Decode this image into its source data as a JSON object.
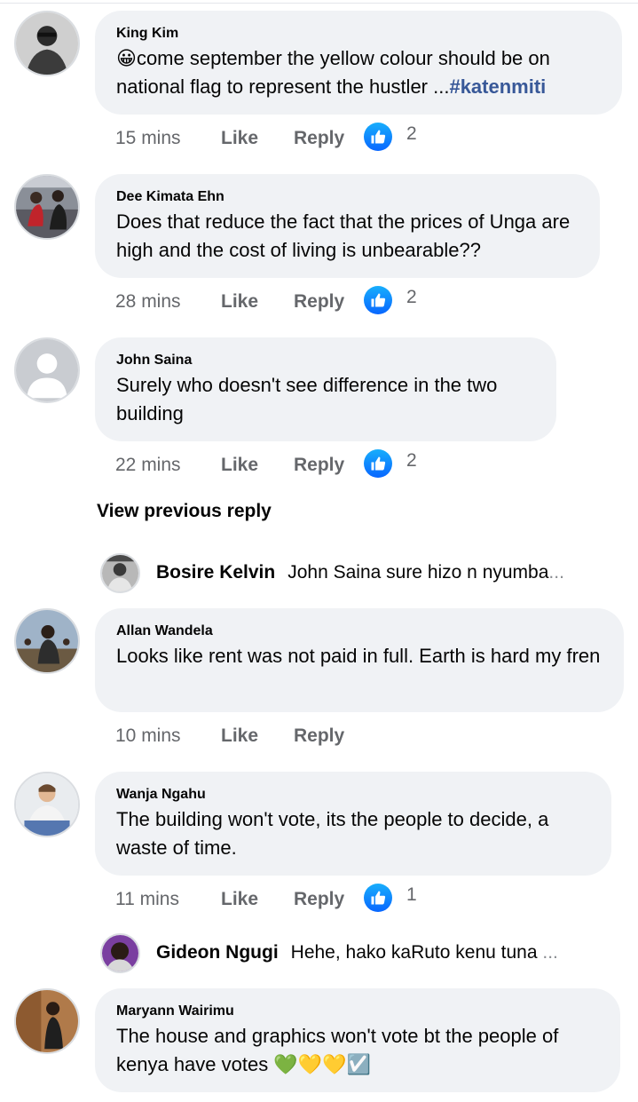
{
  "comments": [
    {
      "author": "King Kim",
      "emoji": "😀",
      "text": "come september the yellow colour should be on national flag to represent the hustler ...",
      "hashtag": "#katenmiti",
      "time": "15 mins",
      "like": "Like",
      "reply": "Reply",
      "reactions": "2"
    },
    {
      "author": "Dee Kimata Ehn",
      "text": "Does that reduce the fact that the prices of Unga are high and the cost of living is unbearable??",
      "time": "28 mins",
      "like": "Like",
      "reply": "Reply",
      "reactions": "2"
    },
    {
      "author": "John Saina",
      "text": "Surely who doesn't see difference in the two building",
      "time": "22 mins",
      "like": "Like",
      "reply": "Reply",
      "reactions": "2",
      "view_previous": "View previous reply",
      "reply_preview": {
        "author": "Bosire Kelvin",
        "text": "John Saina sure hizo n nyumba",
        "ellipsis": "..."
      }
    },
    {
      "author": "Allan Wandela",
      "text": "Looks like rent was not paid in full. Earth is hard my fren",
      "time": "10 mins",
      "like": "Like",
      "reply": "Reply"
    },
    {
      "author": "Wanja Ngahu",
      "text": "The building won't vote, its the people to decide, a waste of time.",
      "time": "11 mins",
      "like": "Like",
      "reply": "Reply",
      "reactions": "1",
      "reply_preview": {
        "author": "Gideon Ngugi",
        "text": "Hehe, hako kaRuto kenu tuna",
        "ellipsis": "..."
      }
    },
    {
      "author": "Maryann Wairimu",
      "text": "The house and graphics won't vote bt the people of kenya have votes",
      "emojis": "💚💛💛☑️"
    }
  ],
  "icons": {
    "reaction": "like-thumb-icon",
    "accent": "#1877f2",
    "link_color": "#385898"
  }
}
